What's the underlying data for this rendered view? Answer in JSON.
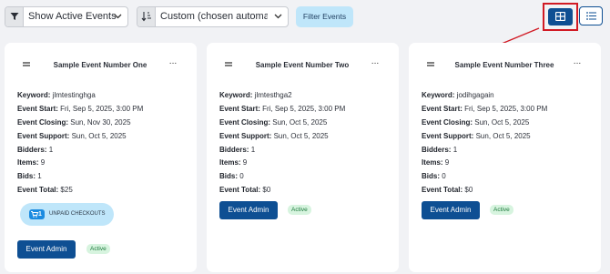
{
  "toolbar": {
    "event_filter": {
      "value": "Show Active Events",
      "icon": "funnel-icon"
    },
    "sort": {
      "value": "Custom (chosen automatical",
      "icon": "sort-icon"
    },
    "filter_button": "Filter Events",
    "view_grid_icon": "grid-view-icon",
    "view_list_icon": "list-view-icon"
  },
  "labels": {
    "keyword": "Keyword:",
    "event_start": "Event Start:",
    "event_closing": "Event Closing:",
    "event_support": "Event Support:",
    "bidders": "Bidders:",
    "items": "Items:",
    "bids": "Bids:",
    "event_total": "Event Total:",
    "more": "···"
  },
  "events": [
    {
      "title": "Sample Event Number One",
      "keyword": "jlmtestinghga",
      "event_start": "Fri, Sep 5, 2025, 3:00 PM",
      "event_closing": "Sun, Nov 30, 2025",
      "event_support": "Sun, Oct 5, 2025",
      "bidders": "1",
      "items": "9",
      "bids": "1",
      "event_total": "$25",
      "unpaid_count": "1",
      "unpaid_label": "UNPAID CHECKOUTS",
      "admin_button": "Event Admin",
      "status": "Active"
    },
    {
      "title": "Sample Event Number Two",
      "keyword": "jlmtesthga2",
      "event_start": "Fri, Sep 5, 2025, 3:00 PM",
      "event_closing": "Sun, Oct 5, 2025",
      "event_support": "Sun, Oct 5, 2025",
      "bidders": "1",
      "items": "9",
      "bids": "0",
      "event_total": "$0",
      "admin_button": "Event Admin",
      "status": "Active"
    },
    {
      "title": "Sample Event Number Three",
      "keyword": "jodihgagain",
      "event_start": "Fri, Sep 5, 2025, 3:00 PM",
      "event_closing": "Sun, Oct 5, 2025",
      "event_support": "Sun, Oct 5, 2025",
      "bidders": "1",
      "items": "9",
      "bids": "0",
      "event_total": "$0",
      "admin_button": "Event Admin",
      "status": "Active"
    }
  ],
  "colors": {
    "primary": "#0e4f93",
    "light_blue": "#bfe6fa",
    "highlight_red": "#d11a24",
    "active_badge_bg": "#d7f4df",
    "active_badge_text": "#1d7a3c"
  }
}
